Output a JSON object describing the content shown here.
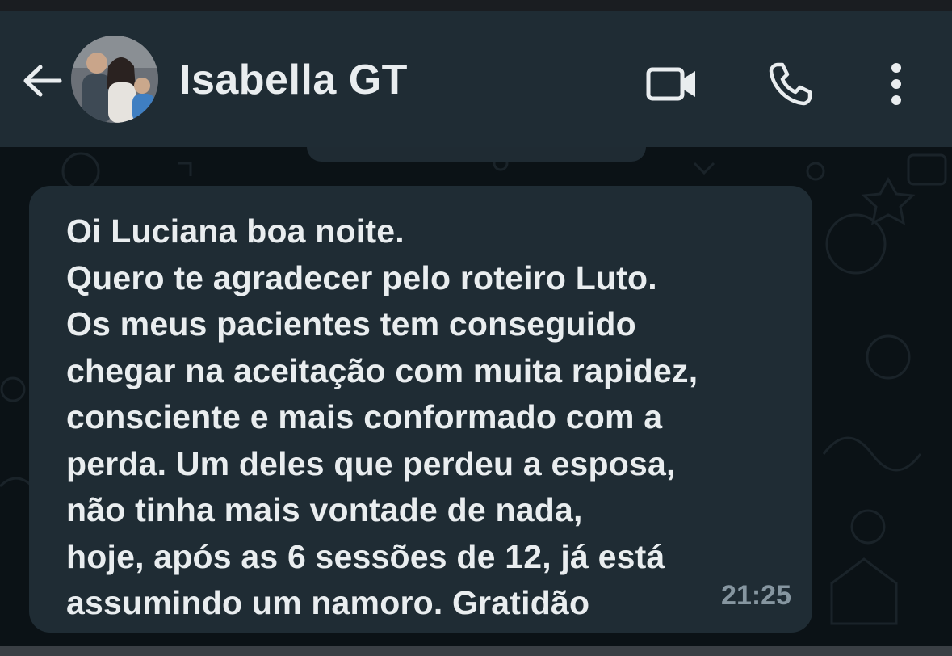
{
  "header": {
    "contact_name": "Isabella GT"
  },
  "icons": {
    "back": "arrow-left-icon",
    "video": "video-call-icon",
    "call": "phone-icon",
    "menu": "more-vertical-icon"
  },
  "message": {
    "lines": [
      "Oi Luciana boa noite.",
      "Quero te agradecer pelo roteiro Luto.",
      "Os meus pacientes tem conseguido",
      "chegar na aceitação com muita rapidez,",
      "consciente e mais conformado com a",
      "perda. Um deles que perdeu a esposa,",
      "não tinha mais vontade de nada,",
      "hoje, após as 6 sessões de 12, já está",
      "assumindo um namoro. Gratidão"
    ],
    "time": "21:25"
  },
  "colors": {
    "header_bg": "#1f2c34",
    "chat_bg": "#0b1216",
    "bubble_bg": "#1f2c34",
    "text": "#e9edef",
    "meta_text": "#8696a0"
  }
}
